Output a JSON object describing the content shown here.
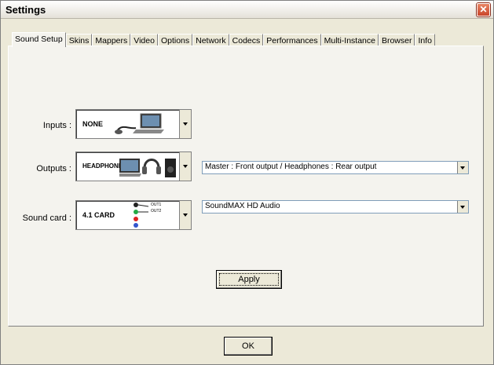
{
  "window": {
    "title": "Settings"
  },
  "tabs": [
    {
      "label": "Sound Setup"
    },
    {
      "label": "Skins"
    },
    {
      "label": "Mappers"
    },
    {
      "label": "Video"
    },
    {
      "label": "Options"
    },
    {
      "label": "Network"
    },
    {
      "label": "Codecs"
    },
    {
      "label": "Performances"
    },
    {
      "label": "Multi-Instance"
    },
    {
      "label": "Browser"
    },
    {
      "label": "Info"
    }
  ],
  "sound_setup": {
    "inputs": {
      "label": "Inputs :",
      "value": "NONE"
    },
    "outputs": {
      "label": "Outputs :",
      "value": "HEADPHONES",
      "mode": "Master : Front output / Headphones : Rear output"
    },
    "sound_card": {
      "label": "Sound card :",
      "value": "4.1 CARD",
      "out1": "OUT1",
      "out2": "OUT2",
      "device": "SoundMAX HD Audio"
    },
    "apply_label": "Apply"
  },
  "ok_label": "OK",
  "colors": {
    "close": "#c9442a",
    "green_jack": "#22aa44",
    "red_jack": "#dd2222",
    "blue_jack": "#3355cc"
  }
}
